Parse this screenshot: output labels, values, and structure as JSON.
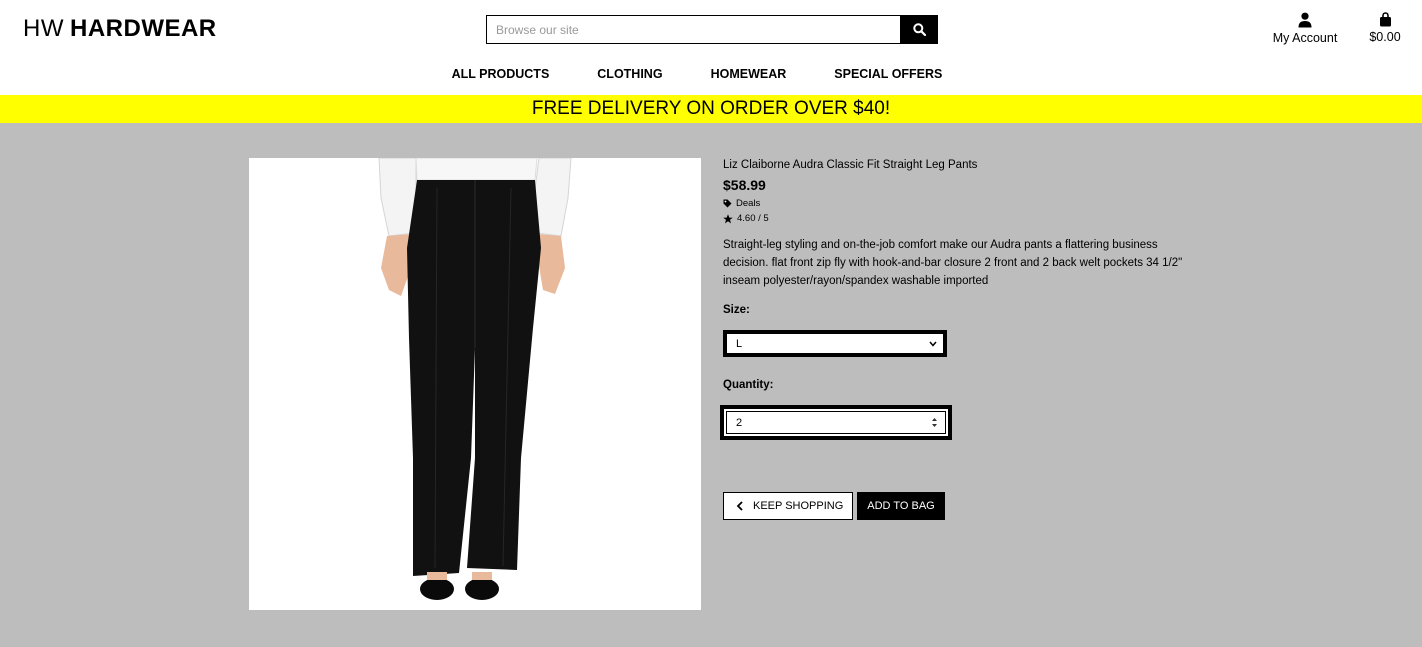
{
  "header": {
    "logo_prefix": "HW",
    "logo_brand": "HARDWEAR",
    "search": {
      "placeholder": "Browse our site",
      "icon": "search-icon"
    },
    "account": {
      "label": "My Account",
      "icon": "user-icon"
    },
    "bag": {
      "total": "$0.00",
      "icon": "shopping-bag-icon"
    }
  },
  "nav": {
    "items": [
      {
        "label": "ALL PRODUCTS"
      },
      {
        "label": "CLOTHING"
      },
      {
        "label": "HOMEWEAR"
      },
      {
        "label": "SPECIAL OFFERS"
      }
    ]
  },
  "banner": {
    "text": "FREE DELIVERY ON ORDER OVER $40!",
    "color": "#ffff00"
  },
  "product": {
    "name": "Liz Claiborne Audra Classic Fit Straight Leg Pants",
    "price": "$58.99",
    "category": "Deals",
    "category_icon": "tag-icon",
    "rating": "4.60 / 5",
    "rating_icon": "star-icon",
    "description": "Straight-leg styling and on-the-job comfort make our Audra pants a flattering business decision. flat front zip fly with hook-and-bar closure 2 front and 2 back welt pockets 34 1/2\" inseam polyester/rayon/spandex washable imported",
    "size_label": "Size:",
    "size_value": "L",
    "quantity_label": "Quantity:",
    "quantity_value": "2",
    "keep_shopping_label": "KEEP SHOPPING",
    "add_to_bag_label": "ADD TO BAG"
  },
  "colors": {
    "background": "#bdbdbd",
    "accent": "#000000"
  }
}
